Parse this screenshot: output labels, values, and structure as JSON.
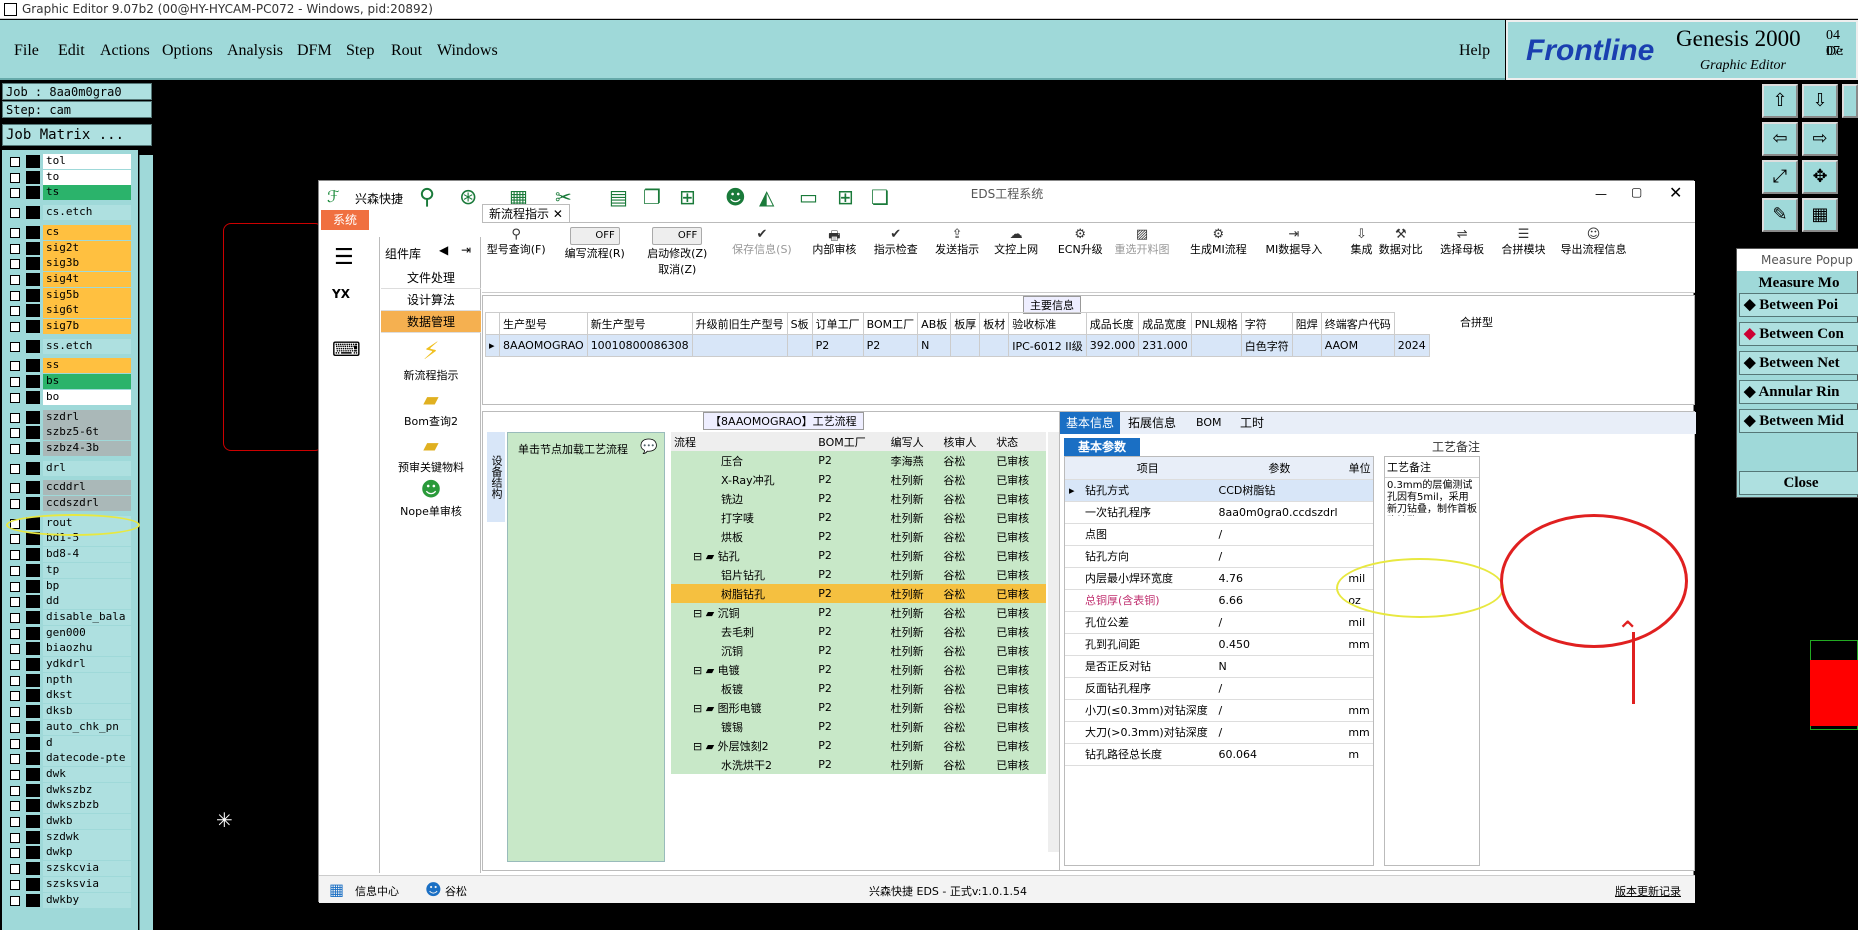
{
  "window_title": "Graphic Editor 9.07b2 (00@HY-HYCAM-PC072 - Windows, pid:20892)",
  "menu": [
    "File",
    "Edit",
    "Actions",
    "Options",
    "Analysis",
    "DFM",
    "Step",
    "Rout",
    "Windows"
  ],
  "help": "Help",
  "brand": {
    "name": "Frontline",
    "product": "Genesis 2000",
    "sub": "Graphic Editor",
    "date": "04 De",
    "time": "07:"
  },
  "job": {
    "job_line": "Job : 8aa0m0gra0",
    "step_line": "Step: cam",
    "matrix_btn": "Job Matrix ..."
  },
  "layers": [
    {
      "name": "tol",
      "color": "#ffffff"
    },
    {
      "name": "to",
      "color": "#ffffff"
    },
    {
      "name": "ts",
      "color": "#2bb36b"
    },
    {
      "name": "cs.etch",
      "color": "#aee0e0"
    },
    {
      "name": "cs",
      "color": "#ffc040"
    },
    {
      "name": "sig2t",
      "color": "#ffc040"
    },
    {
      "name": "sig3b",
      "color": "#ffc040"
    },
    {
      "name": "sig4t",
      "color": "#ffc040"
    },
    {
      "name": "sig5b",
      "color": "#ffc040"
    },
    {
      "name": "sig6t",
      "color": "#ffc040"
    },
    {
      "name": "sig7b",
      "color": "#ffc040"
    },
    {
      "name": "ss.etch",
      "color": "#aee0e0"
    },
    {
      "name": "ss",
      "color": "#ffc040"
    },
    {
      "name": "bs",
      "color": "#2bb36b"
    },
    {
      "name": "bo",
      "color": "#ffffff"
    },
    {
      "name": "szdrl",
      "color": "#aab8b8"
    },
    {
      "name": "szbz5-6t",
      "color": "#aab8b8"
    },
    {
      "name": "szbz4-3b",
      "color": "#aab8b8"
    },
    {
      "name": "drl",
      "color": "#aee0e0"
    },
    {
      "name": "ccddrl",
      "color": "#aab8b8"
    },
    {
      "name": "ccdszdrl",
      "color": "#aab8b8"
    },
    {
      "name": "rout",
      "color": "#aee0e0"
    },
    {
      "name": "bd1-5",
      "color": "#aee0e0"
    },
    {
      "name": "bd8-4",
      "color": "#aee0e0"
    },
    {
      "name": "tp",
      "color": "#aee0e0"
    },
    {
      "name": "bp",
      "color": "#aee0e0"
    },
    {
      "name": "dd",
      "color": "#aee0e0"
    },
    {
      "name": "disable_bala",
      "color": "#aee0e0"
    },
    {
      "name": "gen000",
      "color": "#aee0e0"
    },
    {
      "name": "biaozhu",
      "color": "#aee0e0"
    },
    {
      "name": "ydkdrl",
      "color": "#aee0e0"
    },
    {
      "name": "npth",
      "color": "#aee0e0"
    },
    {
      "name": "dkst",
      "color": "#aee0e0"
    },
    {
      "name": "dksb",
      "color": "#aee0e0"
    },
    {
      "name": "auto_chk_pn",
      "color": "#aee0e0"
    },
    {
      "name": "d",
      "color": "#aee0e0"
    },
    {
      "name": "datecode-pte",
      "color": "#aee0e0"
    },
    {
      "name": "dwk",
      "color": "#aee0e0"
    },
    {
      "name": "dwkszbz",
      "color": "#aee0e0"
    },
    {
      "name": "dwkszbzb",
      "color": "#aee0e0"
    },
    {
      "name": "dwkb",
      "color": "#aee0e0"
    },
    {
      "name": "szdwk",
      "color": "#aee0e0"
    },
    {
      "name": "dwkp",
      "color": "#aee0e0"
    },
    {
      "name": "szskcvia",
      "color": "#aee0e0"
    },
    {
      "name": "szsksvia",
      "color": "#aee0e0"
    },
    {
      "name": "dwkby",
      "color": "#aee0e0"
    }
  ],
  "eds": {
    "title": "EDS工程系统",
    "brand": "兴森快捷",
    "sys_tab": "系统",
    "tab": "新流程指示",
    "component_lib": "组件库",
    "lib_items": [
      "文件处理",
      "设计算法",
      "数据管理"
    ],
    "sub_items": [
      "新流程指示",
      "Bom查询2",
      "预审关键物料",
      "Nope单审核"
    ],
    "toolbar": [
      "型号查询(F)",
      "编写流程(R)",
      "启动修改(Z)",
      "保存信息(S)",
      "内部审核",
      "指示检查",
      "发送指示",
      "文控上网",
      "ECN升级",
      "重选开料图",
      "生成MI流程",
      "MI数据导入",
      "集成",
      "数据对比",
      "选择母板",
      "合拼模块",
      "导出流程信息"
    ],
    "toggle_off": "OFF",
    "cancel": "取消(Z)",
    "main_info": "主要信息",
    "grid_headers": [
      "生产型号",
      "新生产型号",
      "升级前旧生产型号",
      "S板",
      "订单工厂",
      "BOM工厂",
      "AB板",
      "板厚",
      "板材",
      "验收标准",
      "成品长度",
      "成品宽度",
      "PNL规格",
      "字符",
      "阻焊",
      "终端客户代码"
    ],
    "grid_row": [
      "8AAOMOGRAO",
      "10010800086308",
      "",
      "",
      "P2",
      "P2",
      "N",
      "",
      "",
      "IPC-6012 II级",
      "392.000",
      "231.000",
      "",
      "白色字符",
      "",
      "AAOM"
    ],
    "grid_extra": "2024",
    "merge_col": "合拼型",
    "flow_title": "【8AAOMOGRAO】工艺流程",
    "flow_side": "设备结构",
    "flow_hint": "单击节点加载工艺流程",
    "flow_headers": [
      "流程",
      "BOM工厂",
      "编写人",
      "核审人",
      "状态"
    ],
    "flow_rows": [
      {
        "name": "压合",
        "f": "P2",
        "w": "李海燕",
        "r": "谷松",
        "s": "已审核",
        "lvl": 2
      },
      {
        "name": "X-Ray冲孔",
        "f": "P2",
        "w": "杜列新",
        "r": "谷松",
        "s": "已审核",
        "lvl": 2
      },
      {
        "name": "铣边",
        "f": "P2",
        "w": "杜列新",
        "r": "谷松",
        "s": "已审核",
        "lvl": 2
      },
      {
        "name": "打字唛",
        "f": "P2",
        "w": "杜列新",
        "r": "谷松",
        "s": "已审核",
        "lvl": 2
      },
      {
        "name": "烘板",
        "f": "P2",
        "w": "杜列新",
        "r": "谷松",
        "s": "已审核",
        "lvl": 2
      },
      {
        "name": "钻孔",
        "f": "P2",
        "w": "杜列新",
        "r": "谷松",
        "s": "已审核",
        "lvl": 1
      },
      {
        "name": "铝片钻孔",
        "f": "P2",
        "w": "杜列新",
        "r": "谷松",
        "s": "已审核",
        "lvl": 2
      },
      {
        "name": "树脂钻孔",
        "f": "P2",
        "w": "杜列新",
        "r": "谷松",
        "s": "已审核",
        "lvl": 2,
        "sel": true
      },
      {
        "name": "沉铜",
        "f": "P2",
        "w": "杜列新",
        "r": "谷松",
        "s": "已审核",
        "lvl": 1
      },
      {
        "name": "去毛刺",
        "f": "P2",
        "w": "杜列新",
        "r": "谷松",
        "s": "已审核",
        "lvl": 2
      },
      {
        "name": "沉铜",
        "f": "P2",
        "w": "杜列新",
        "r": "谷松",
        "s": "已审核",
        "lvl": 2
      },
      {
        "name": "电镀",
        "f": "P2",
        "w": "杜列新",
        "r": "谷松",
        "s": "已审核",
        "lvl": 1
      },
      {
        "name": "板镀",
        "f": "P2",
        "w": "杜列新",
        "r": "谷松",
        "s": "已审核",
        "lvl": 2
      },
      {
        "name": "图形电镀",
        "f": "P2",
        "w": "杜列新",
        "r": "谷松",
        "s": "已审核",
        "lvl": 1
      },
      {
        "name": "镀锡",
        "f": "P2",
        "w": "杜列新",
        "r": "谷松",
        "s": "已审核",
        "lvl": 2
      },
      {
        "name": "外层蚀刻2",
        "f": "P2",
        "w": "杜列新",
        "r": "谷松",
        "s": "已审核",
        "lvl": 1
      },
      {
        "name": "水洗烘干2",
        "f": "P2",
        "w": "杜列新",
        "r": "谷松",
        "s": "已审核",
        "lvl": 2
      }
    ],
    "info_tabs": [
      "基本信息",
      "拓展信息",
      "BOM",
      "工时"
    ],
    "basic_params": "基本参数",
    "process_note": "工艺备注",
    "process_note_label": "工艺备注",
    "note_text": "0.3mm的层偏测试孔因有5mil，采用新刀钻叠，制作首板确认孔",
    "param_headers": [
      "项目",
      "参数",
      "单位"
    ],
    "params": [
      {
        "k": "钻孔方式",
        "v": "CCD树脂钻",
        "u": ""
      },
      {
        "k": "一次钻孔程序",
        "v": "8aa0m0gra0.ccdszdrl",
        "u": ""
      },
      {
        "k": "点图",
        "v": "/",
        "u": ""
      },
      {
        "k": "钻孔方向",
        "v": "/",
        "u": ""
      },
      {
        "k": "内层最小焊环宽度",
        "v": "4.76",
        "u": "mil"
      },
      {
        "k": "总铜厚(含表铜)",
        "v": "6.66",
        "u": "oz",
        "pink": true
      },
      {
        "k": "孔位公差",
        "v": "/",
        "u": "mil"
      },
      {
        "k": "孔到孔间距",
        "v": "0.450",
        "u": "mm"
      },
      {
        "k": "是否正反对钻",
        "v": "N",
        "u": ""
      },
      {
        "k": "反面钻孔程序",
        "v": "/",
        "u": ""
      },
      {
        "k": "小刀(≤0.3mm)对钻深度",
        "v": "/",
        "u": "mm"
      },
      {
        "k": "大刀(>0.3mm)对钻深度",
        "v": "/",
        "u": "mm"
      },
      {
        "k": "钻孔路径总长度",
        "v": "60.064",
        "u": "m"
      }
    ],
    "status_info": "信息中心",
    "status_user": "谷松",
    "status_version": "兴森快捷 EDS - 正式v:1.0.1.54",
    "status_link": "版本更新记录"
  },
  "measure": {
    "title": "Measure Popup",
    "mode": "Measure Mo",
    "buttons": [
      "Between Poi",
      "Between Con",
      "Between Net",
      "Annular Rin",
      "Between Mid"
    ],
    "close": "Close"
  },
  "colors": {
    "menu_bg": "#9fd9d9",
    "accent": "#1a6fc4",
    "highlight": "#ffc040",
    "annotation_red": "#e02020",
    "annotation_yellow": "#e8e840"
  }
}
